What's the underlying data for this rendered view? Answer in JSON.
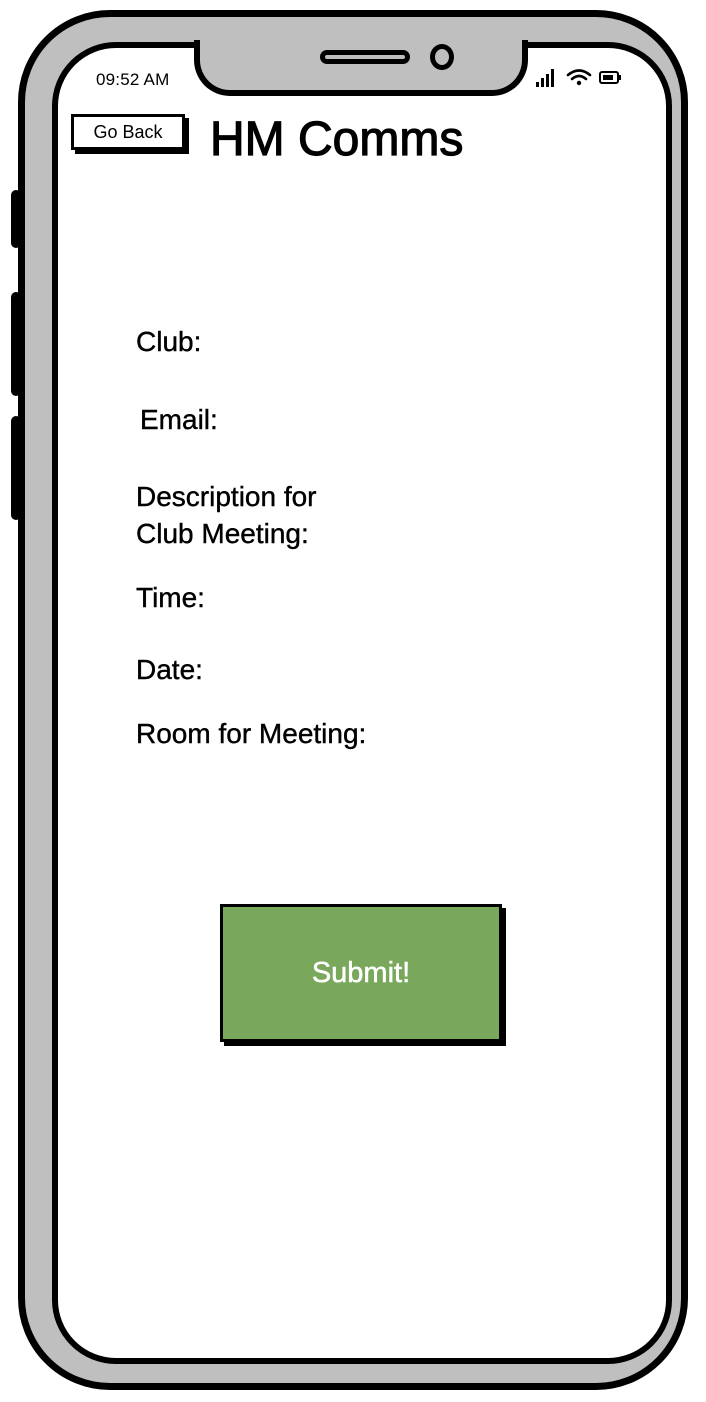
{
  "status_bar": {
    "time": "09:52 AM",
    "icons": [
      "signal-icon",
      "wifi-icon",
      "battery-icon"
    ]
  },
  "header": {
    "back_label": "Go Back",
    "title": "HM Comms"
  },
  "form": {
    "club_label": "Club:",
    "email_label": "Email:",
    "description_label_line1": "Description for",
    "description_label_line2": "Club Meeting:",
    "time_label": "Time:",
    "date_label": "Date:",
    "room_label": "Room for Meeting:"
  },
  "submit": {
    "label": "Submit!"
  },
  "colors": {
    "submit_fill": "#79a75b",
    "frame_fill": "#bfbfbf",
    "outline": "#000000"
  }
}
